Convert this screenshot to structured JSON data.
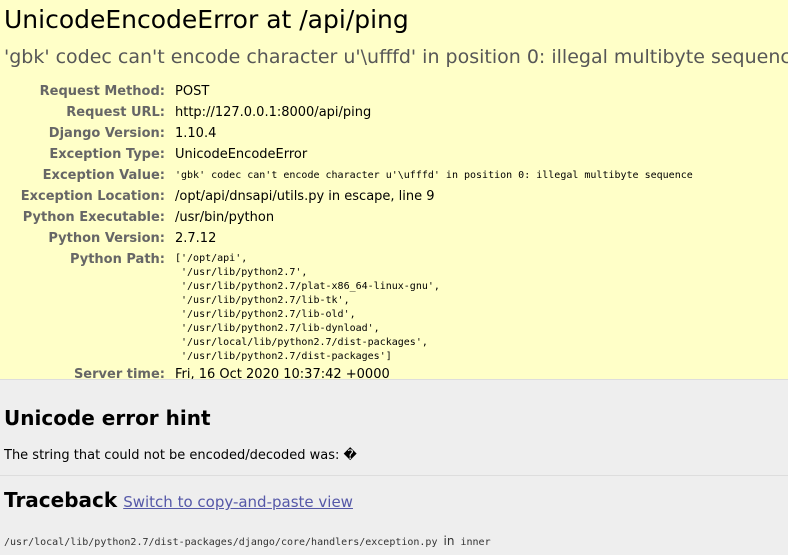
{
  "summary": {
    "title": "UnicodeEncodeError at /api/ping",
    "exception_value": "'gbk' codec can't encode character u'\\ufffd' in position 0: illegal multibyte sequence",
    "labels": {
      "request_method": "Request Method:",
      "request_url": "Request URL:",
      "django_version": "Django Version:",
      "exception_type": "Exception Type:",
      "exception_value": "Exception Value:",
      "exception_location": "Exception Location:",
      "python_executable": "Python Executable:",
      "python_version": "Python Version:",
      "python_path": "Python Path:",
      "server_time": "Server time:"
    },
    "values": {
      "request_method": "POST",
      "request_url": "http://127.0.0.1:8000/api/ping",
      "django_version": "1.10.4",
      "exception_type": "UnicodeEncodeError",
      "exception_value": "'gbk' codec can't encode character u'\\ufffd' in position 0: illegal multibyte sequence",
      "exception_location": "/opt/api/dnsapi/utils.py in escape, line 9",
      "python_executable": "/usr/bin/python",
      "python_version": "2.7.12",
      "python_path": "['/opt/api',\n '/usr/lib/python2.7',\n '/usr/lib/python2.7/plat-x86_64-linux-gnu',\n '/usr/lib/python2.7/lib-tk',\n '/usr/lib/python2.7/lib-old',\n '/usr/lib/python2.7/lib-dynload',\n '/usr/local/lib/python2.7/dist-packages',\n '/usr/lib/python2.7/dist-packages']",
      "server_time": "Fri, 16 Oct 2020 10:37:42 +0000"
    }
  },
  "unicode_hint": {
    "heading": "Unicode error hint",
    "text": "The string that could not be encoded/decoded was: �"
  },
  "traceback": {
    "heading": "Traceback",
    "switch_link": "Switch to copy-and-paste view",
    "frame_file": "/usr/local/lib/python2.7/dist-packages/django/core/handlers/exception.py",
    "frame_in": "in",
    "frame_func": "inner"
  }
}
